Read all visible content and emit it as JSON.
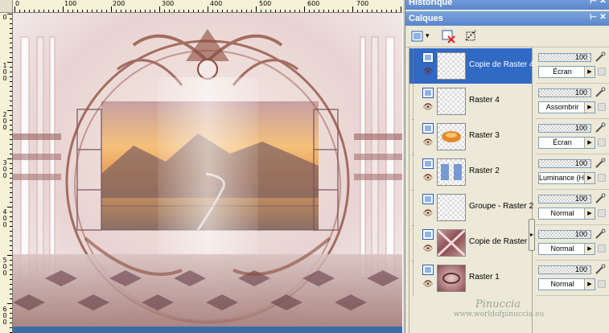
{
  "rulers": {
    "horizontal_labels": [
      "0",
      "100",
      "200",
      "300",
      "400",
      "500",
      "600",
      "700"
    ],
    "vertical_labels": [
      "0",
      "100",
      "200",
      "300",
      "400",
      "500",
      "600"
    ]
  },
  "panels": {
    "history_title": "Historique",
    "layers_title": "Calques",
    "pin_glyph": "⊢",
    "close_glyph": "✕"
  },
  "toolbar": {
    "new_layer_icon": "new-raster-layer-icon",
    "delete_layer_icon": "delete-layer-icon",
    "mask_icon": "mask-icon",
    "dropdown_glyph": "▾"
  },
  "layers": [
    {
      "name": "Copie de Raster 4",
      "opacity": "100",
      "blend": "Écran",
      "selected": true,
      "thumb": "empty"
    },
    {
      "name": "Raster 4",
      "opacity": "100",
      "blend": "Assombrir",
      "selected": false,
      "thumb": "empty"
    },
    {
      "name": "Raster 3",
      "opacity": "100",
      "blend": "Écran",
      "selected": false,
      "thumb": "sunset"
    },
    {
      "name": "Raster 2",
      "opacity": "100",
      "blend": "Luminance (H)",
      "selected": false,
      "thumb": "windows"
    },
    {
      "name": "Groupe - Raster 2",
      "opacity": "100",
      "blend": "Normal",
      "selected": false,
      "thumb": "empty"
    },
    {
      "name": "Copie de Raster 1",
      "opacity": "100",
      "blend": "Normal",
      "selected": false,
      "thumb": "pattern"
    },
    {
      "name": "Raster 1",
      "opacity": "100",
      "blend": "Normal",
      "selected": false,
      "thumb": "pattern2"
    }
  ],
  "glyphs": {
    "eye": "👁",
    "dropdown_arrow": "▶",
    "scroll_arrow": "▸"
  },
  "watermark": {
    "title": "Pinuccia",
    "url": "www.worldofpinuccia.eu"
  },
  "colors": {
    "titlebar": "#5a86cc",
    "selection": "#316ac5",
    "canvas_accent": "#8b4a3a"
  }
}
